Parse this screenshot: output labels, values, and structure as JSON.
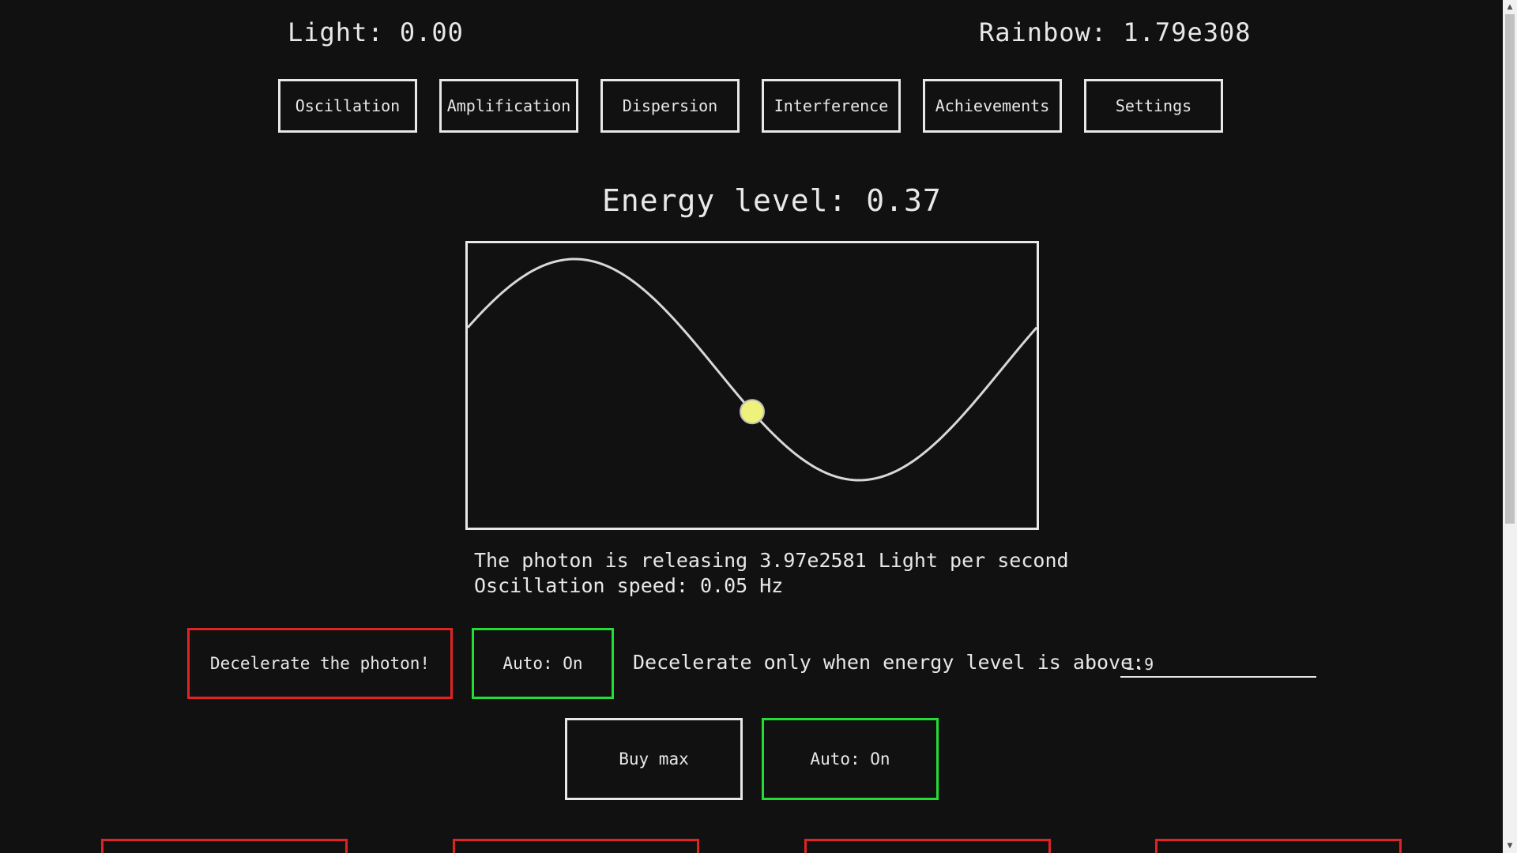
{
  "resources": {
    "light": "Light: 0.00",
    "rainbow": "Rainbow: 1.79e308"
  },
  "tabs": [
    {
      "label": "Oscillation"
    },
    {
      "label": "Amplification"
    },
    {
      "label": "Dispersion"
    },
    {
      "label": "Interference"
    },
    {
      "label": "Achievements"
    },
    {
      "label": "Settings"
    }
  ],
  "energy": {
    "label": "Energy level: 0.37",
    "value": 0.37
  },
  "wave": {
    "photon_phase": 0.5,
    "line_color": "#d8d8d8",
    "photon_color": "#eef27a"
  },
  "info": {
    "release_rate": "The photon is releasing 3.97e2581 Light per second",
    "oscillation_speed": "Oscillation speed: 0.05 Hz"
  },
  "decelerate": {
    "button_label": "Decelerate the photon!",
    "auto_label": "Auto: On",
    "threshold_label": "Decelerate only when energy level is above:",
    "threshold_value": "1.9"
  },
  "buy": {
    "buy_max_label": "Buy max",
    "auto_label": "Auto: On"
  },
  "colors": {
    "background": "#111111",
    "text": "#e8e8e8",
    "red": "#e02424",
    "green": "#22dd33"
  }
}
